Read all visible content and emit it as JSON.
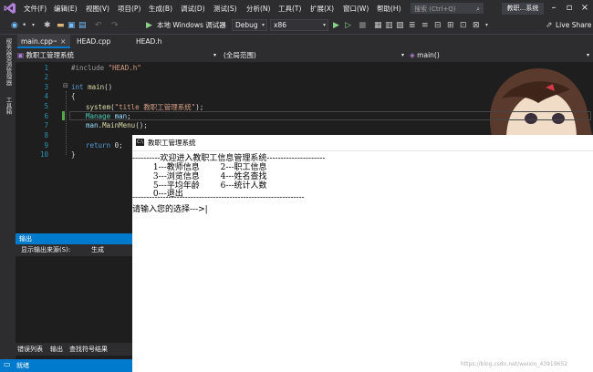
{
  "menubar": {
    "items": [
      "文件(F)",
      "编辑(E)",
      "视图(V)",
      "项目(P)",
      "生成(B)",
      "调试(D)",
      "测试(S)",
      "分析(N)",
      "工具(T)",
      "扩展(X)",
      "窗口(W)",
      "帮助(H)"
    ],
    "search_placeholder": "搜索 (Ctrl+Q)",
    "solution_badge": "教职...系统"
  },
  "toolbar": {
    "run_label": "本地 Windows 调试器",
    "config": "Debug",
    "platform": "x86",
    "live_share": "Live Share"
  },
  "leftstrip": {
    "labels": [
      "服务器资源管理器",
      "工具箱"
    ]
  },
  "tabs": [
    {
      "label": "main.cpp",
      "active": true
    },
    {
      "label": "HEAD.cpp",
      "active": false
    },
    {
      "label": "HEAD.h",
      "active": false
    }
  ],
  "navbar": {
    "project": "教职工管理系统",
    "scope": "(全局范围)",
    "member": "main()"
  },
  "editor": {
    "line_numbers": [
      "1",
      "2",
      "3",
      "4",
      "5",
      "6",
      "7",
      "8",
      "9",
      "10"
    ],
    "lines": {
      "l1_pp": "#include ",
      "l1_str": "\"HEAD.h\"",
      "l3_kw": "int ",
      "l3_fn": "main",
      "l3_rest": "()",
      "l4": "{",
      "l5_fn": "system",
      "l5_a": "(",
      "l5_str": "\"title 教职工管理系统\"",
      "l5_b": ");",
      "l6_ty": "Manage ",
      "l6_var": "man",
      "l6_b": ";",
      "l7_var": "man",
      "l7_a": ".",
      "l7_fn": "MainMenu",
      "l7_b": "();",
      "l9_kw": "return ",
      "l9_b": "0;",
      "l10": "}"
    }
  },
  "console": {
    "title": "教职工管理系统",
    "icon_text": "C:\\",
    "lines": [
      "----------欢迎进入教职工信息管理系统---------------------",
      "        1---教师信息        2---职工信息",
      "        3---浏览信息        4---姓名查找",
      "        5---平均年龄        6---统计人数",
      "        0---退出",
      "--------------------------------------------------------------",
      "请输入您的选择--->|"
    ],
    "watermark": "https://blog.csdn.net/weixin_43919652"
  },
  "output": {
    "title": "输出",
    "source_label": "显示输出来源(S):",
    "source_value": "生成",
    "bottom_tabs": [
      "错误列表",
      "输出",
      "查找符号结果"
    ]
  },
  "statusbar": {
    "text": "就绪"
  },
  "colors": {
    "accent": "#007acc",
    "chrome": "#2d2d30",
    "editor_bg": "#1e1e1e"
  }
}
